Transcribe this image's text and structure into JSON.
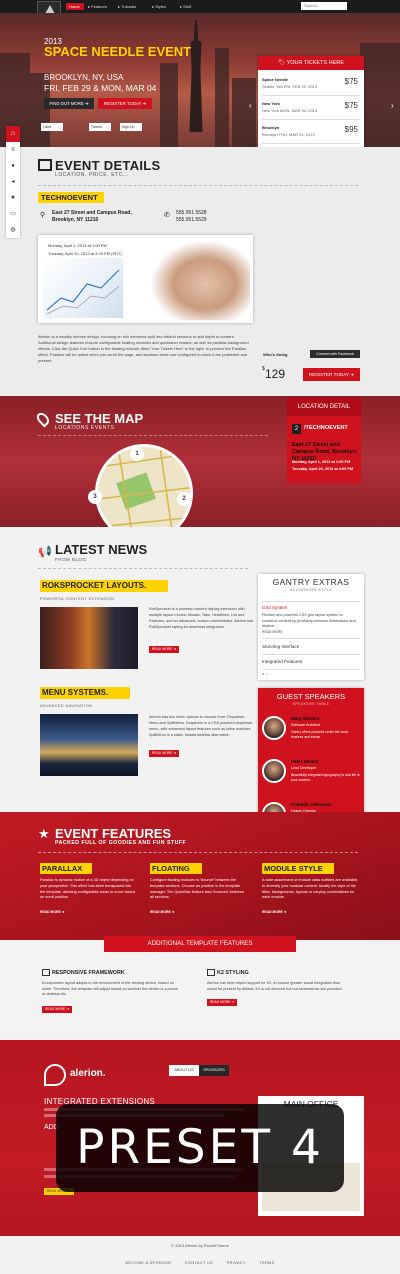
{
  "nav": {
    "logo": "alerion.",
    "items": [
      "Home",
      "Features",
      "Tutorials",
      "Styles",
      "Stuff"
    ],
    "search_placeholder": "Search..."
  },
  "hero": {
    "year": "2013",
    "title": "SPACE NEEDLE EVENT",
    "location": "BROOKLYN, NY, USA",
    "dates": "FRI, FEB 29 & MON, MAR 04",
    "find_out_more": "FIND OUT MORE",
    "register_today": "REGISTER TODAY",
    "social": [
      "Likes",
      "Tweets",
      "Sign Up"
    ]
  },
  "tickets": {
    "title": "YOUR TICKETS HERE",
    "rows": [
      {
        "name": "Space Needle",
        "date": "Seattle, WA FRI, FEB 29, 2013",
        "price": "$75"
      },
      {
        "name": "New York",
        "date": "New York MON, MAR 04, 2013",
        "price": "$75"
      },
      {
        "name": "Brooklyn",
        "date": "Brooklyn THU, MAR 21, 2013",
        "price": "$95"
      }
    ],
    "quick_tour": "QUICK TOUR"
  },
  "event_details": {
    "title": "EVENT DETAILS",
    "subtitle": "LOCATION, PRICE, ETC...",
    "badge": "TECHNOEVENT",
    "address1": "East 27 Street and Campus Road,",
    "address2": "Brooklyn, NY 11210",
    "phone1": "555.951.5528",
    "phone2": "555.951.5529",
    "date1": "Monday, April 1, 2013 at 1:00 PM",
    "date2": "Tuesday, April 20, 2013 at 4:00 PM (PDT)",
    "body": "Alerion is a visually intense design, focusing on rich elements split into distinct sections to add depth to content. Additional design features include configurable floating modules and quicklaner feature, as well as parallax background effects. Click the Quick Tour button in the floating module, titled 'Your Tickets Here' to the right, to preview the Parallax effect. Parallax will be active when you scroll the page, and sections which are configured to show it are published and present.",
    "whos_going": "Who's Going",
    "connect_fb": "Connect with Facebook",
    "price_currency": "$",
    "price": "129",
    "register_today": "REGISTER TODAY"
  },
  "map": {
    "title": "SEE THE MAP",
    "subtitle": "LOCATIONS EVENTS",
    "markers": [
      "1",
      "2",
      "3"
    ]
  },
  "location_detail": {
    "title": "LOCATION DETAIL",
    "number": "2",
    "name": "/TECHNOEVENT",
    "address": "East 27 Street and Campus Road, Brooklyn, NY 11210",
    "time1": "Monday, April 1, 2013 at 1:00 PM",
    "time2": "Tuesday, April 20, 2013 at 4:00 PM"
  },
  "news": {
    "title": "LATEST NEWS",
    "subtitle": "FROM BLOG",
    "items": [
      {
        "title": "ROKSPROCKET LAYOUTS.",
        "tag": "POWERFUL CONTENT EXTENSION",
        "text": "RokSprocket is a powerful content display extension with multiple layout modes: Mosaic, Tabs, Headlines, List and Features, and an advanced, custom administrator. Alerion has RokSprocket styling for seamless integration.",
        "more": "READ MORE"
      },
      {
        "title": "MENU SYSTEMS.",
        "tag": "ADVANCED NAVIGATION",
        "text": "Alerion has two menu options to choose from: Dropdown Menu and SplitMenu. Dropdown is a CSS powered dropdown menu, with advanced layout features such as inline modules. SplitMenu is a static, header/sidebar alternative.",
        "more": "READ MORE"
      }
    ]
  },
  "gantry": {
    "title": "GANTRY EXTRAS",
    "subtitle": "ACCORDION STYLE",
    "active": "Grid System",
    "text": "Flexible and powerful CSS grid layout system to construct content by providing common dimensions and relative.",
    "more": "READ MORE",
    "items": [
      "Stunning Interface",
      "Integrated Features"
    ]
  },
  "speakers": {
    "title": "GUEST SPEAKERS",
    "subtitle": "SPEAKERS TABLE",
    "people": [
      {
        "name": "Mary Watson",
        "role": "Software Architect",
        "text": "Gantry offers powerful under the hood features and extras."
      },
      {
        "name": "Peter Walley",
        "role": "Lead Developer",
        "text": "Beautifully integrated typography to add life to your content."
      },
      {
        "name": "Franklin Johnston",
        "role": "Design Director",
        "text": "Integrated styling for K2 and a fully functional blog."
      }
    ]
  },
  "features": {
    "title": "EVENT FEATURES",
    "subtitle": "PACKED FULL OF GOODIES AND FUN STUFF",
    "items": [
      {
        "title": "PARALLAX",
        "text": "Parallax is dynamic motion of a 3D object depending on your perspective. This effect has been transposed into the template, allowing configurable areas to move based on scroll position.",
        "more": "READ MORE"
      },
      {
        "title": "FLOATING",
        "text": "Configure floating modules to 'bounce' between the template sections. Choose an position in the template manager. The QuickNav feature also 'bounces' between all sections.",
        "more": "READ MORE"
      },
      {
        "title": "MODULE STYLE",
        "text": "A wide assortment of module class suffixes are available, to diversify your modular content. Modify the style of the titles, backgrounds, layouts or varying combinations for each module.",
        "more": "READ MORE"
      }
    ]
  },
  "additional": {
    "title": "ADDITIONAL TEMPLATE FEATURES",
    "items": [
      {
        "title": "RESPONSIVE FRAMEWORK",
        "text": "A responsive layout adapts to the environment of the viewing device, based on width. Therefore, the template will adjust based on whether the device is a phone or desktop etc.",
        "more": "READ MORE"
      },
      {
        "title": "K2 STYLING",
        "text": "Alerion has been styled support for K2, to ensure greater visual integration than would be present by default. K2 is not demoed but but screenshots are provided.",
        "more": "READ MORE"
      }
    ]
  },
  "footer": {
    "logo": "alerion.",
    "tabs": [
      "ABOUT US",
      "SPONSORS"
    ],
    "heading1": "INTEGRATED EXTENSIONS",
    "heading2": "ADD",
    "more": "READ MORE",
    "office_title": "MAIN OFFICE"
  },
  "overlay": {
    "label": "PRESET 4"
  },
  "bottom": {
    "copyright": "© 2013 Alerion by RocketTheme",
    "links": [
      "BECOME A SPONSOR",
      "CONTACT US",
      "PRIVACY",
      "TERMS"
    ]
  },
  "colors": {
    "accent": "#d0111e",
    "highlight": "#ffd200",
    "dark": "#1b1b1b"
  }
}
